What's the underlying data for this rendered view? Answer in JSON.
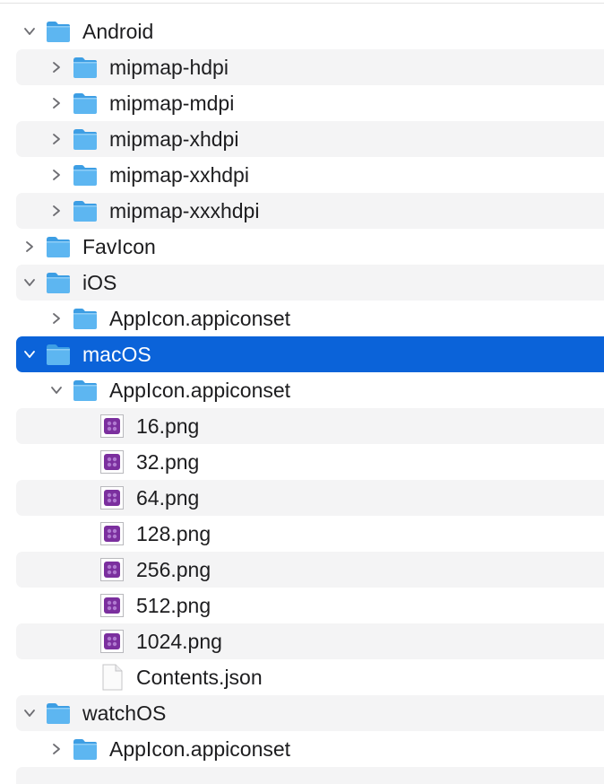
{
  "tree": [
    {
      "label": "Android",
      "depth": 0,
      "expanded": true,
      "kind": "folder",
      "icon": "folder-icon"
    },
    {
      "label": "mipmap-hdpi",
      "depth": 1,
      "expanded": false,
      "kind": "folder",
      "icon": "folder-icon"
    },
    {
      "label": "mipmap-mdpi",
      "depth": 1,
      "expanded": false,
      "kind": "folder",
      "icon": "folder-icon"
    },
    {
      "label": "mipmap-xhdpi",
      "depth": 1,
      "expanded": false,
      "kind": "folder",
      "icon": "folder-icon"
    },
    {
      "label": "mipmap-xxhdpi",
      "depth": 1,
      "expanded": false,
      "kind": "folder",
      "icon": "folder-icon"
    },
    {
      "label": "mipmap-xxxhdpi",
      "depth": 1,
      "expanded": false,
      "kind": "folder",
      "icon": "folder-icon"
    },
    {
      "label": "FavIcon",
      "depth": 0,
      "expanded": false,
      "kind": "folder",
      "icon": "folder-icon"
    },
    {
      "label": "iOS",
      "depth": 0,
      "expanded": true,
      "kind": "folder",
      "icon": "folder-icon"
    },
    {
      "label": "AppIcon.appiconset",
      "depth": 1,
      "expanded": false,
      "kind": "folder",
      "icon": "folder-icon"
    },
    {
      "label": "macOS",
      "depth": 0,
      "expanded": true,
      "kind": "folder",
      "icon": "folder-icon",
      "selected": true
    },
    {
      "label": "AppIcon.appiconset",
      "depth": 1,
      "expanded": true,
      "kind": "folder",
      "icon": "folder-icon"
    },
    {
      "label": "16.png",
      "depth": 2,
      "kind": "png",
      "icon": "png-image-icon"
    },
    {
      "label": "32.png",
      "depth": 2,
      "kind": "png",
      "icon": "png-image-icon"
    },
    {
      "label": "64.png",
      "depth": 2,
      "kind": "png",
      "icon": "png-image-icon"
    },
    {
      "label": "128.png",
      "depth": 2,
      "kind": "png",
      "icon": "png-image-icon"
    },
    {
      "label": "256.png",
      "depth": 2,
      "kind": "png",
      "icon": "png-image-icon"
    },
    {
      "label": "512.png",
      "depth": 2,
      "kind": "png",
      "icon": "png-image-icon"
    },
    {
      "label": "1024.png",
      "depth": 2,
      "kind": "png",
      "icon": "png-image-icon"
    },
    {
      "label": "Contents.json",
      "depth": 2,
      "kind": "json",
      "icon": "json-document-icon"
    },
    {
      "label": "watchOS",
      "depth": 0,
      "expanded": true,
      "kind": "folder",
      "icon": "folder-icon"
    },
    {
      "label": "AppIcon.appiconset",
      "depth": 1,
      "expanded": false,
      "kind": "folder",
      "icon": "folder-icon"
    }
  ],
  "colors": {
    "selection": "#0b63d9",
    "folder": "#5db6f1",
    "png_icon": "#7b2f9e",
    "alternate_row": "#f4f4f5"
  }
}
